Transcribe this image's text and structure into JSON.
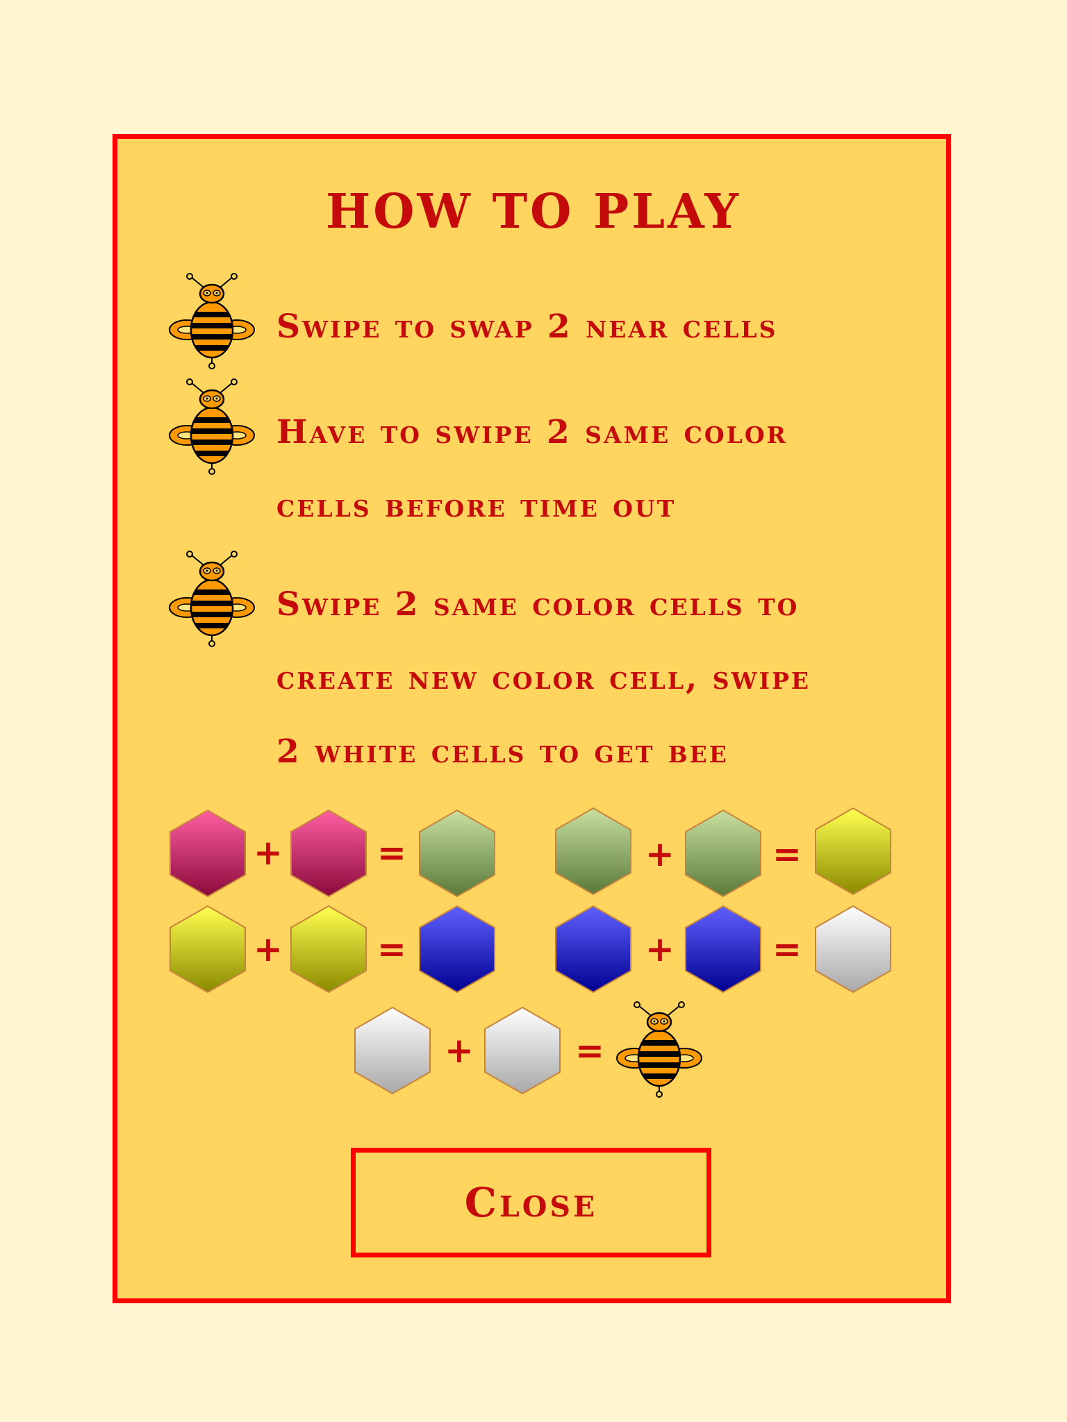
{
  "dialog": {
    "title": "HOW TO PLAY",
    "rules": [
      {
        "lines": [
          "Swipe to swap 2 near cells"
        ]
      },
      {
        "lines": [
          "Have to swipe 2 same color",
          "cells before time out"
        ]
      },
      {
        "lines": [
          "Swipe 2 same color cells to",
          "create new color cell, swipe",
          "2 white cells to get bee"
        ]
      }
    ],
    "operators": {
      "plus": "+",
      "equals": "="
    },
    "combinations": [
      {
        "a": "pink",
        "b": "pink",
        "result": "olive-green"
      },
      {
        "a": "olive-green",
        "b": "olive-green",
        "result": "yellow"
      },
      {
        "a": "yellow",
        "b": "yellow",
        "result": "blue"
      },
      {
        "a": "blue",
        "b": "blue",
        "result": "white"
      },
      {
        "a": "white",
        "b": "white",
        "result": "bee"
      }
    ],
    "close_label": "Close"
  },
  "colors": {
    "background": "#fff5d2",
    "panel": "#ffd45f",
    "border": "#ff0000",
    "text": "#c40a0a",
    "pink": [
      "#ff5fa2",
      "#8a0a3a"
    ],
    "olive-green": [
      "#c8e0a0",
      "#5a7a3a"
    ],
    "yellow": [
      "#ffff50",
      "#8a8a00"
    ],
    "blue": [
      "#6060ff",
      "#000090"
    ],
    "white": [
      "#ffffff",
      "#a8a8a8"
    ]
  }
}
